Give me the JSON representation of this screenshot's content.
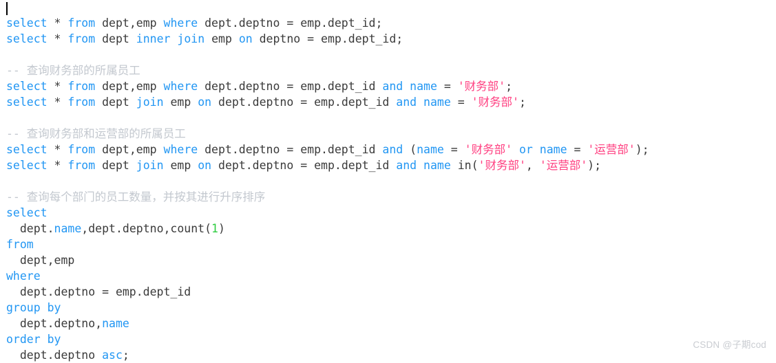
{
  "editor": {
    "background_color": "#ffffff",
    "caret_visible": true,
    "font_size_px": 16.5,
    "line_height_px": 23
  },
  "theme": {
    "keyword_color": "#2196F3",
    "identifier_color": "#3a3a3a",
    "comment_color": "#c3c8cf",
    "string_color": "#ff4081",
    "number_color": "#2ecc40",
    "caret_color": "#000000",
    "watermark_color": "#c9ccd1"
  },
  "watermark": {
    "text": "CSDN @子期cod"
  },
  "code": {
    "language": "sql",
    "plain_text": "select * from dept,emp where dept.deptno = emp.dept_id;\nselect * from dept inner join emp on deptno = emp.dept_id;\n\n-- 查询财务部的所属员工\nselect * from dept,emp where dept.deptno = emp.dept_id and name = '财务部';\nselect * from dept join emp on dept.deptno = emp.dept_id and name = '财务部';\n\n-- 查询财务部和运营部的所属员工\nselect * from dept,emp where dept.deptno = emp.dept_id and (name = '财务部' or name = '运营部');\nselect * from dept join emp on dept.deptno = emp.dept_id and name in('财务部', '运营部');\n\n-- 查询每个部门的员工数量，并按其进行升序排序\nselect\n  dept.name,dept.deptno,count(1)\nfrom\n  dept,emp\nwhere\n  dept.deptno = emp.dept_id\ngroup by\n  dept.deptno,name\norder by\n  dept.deptno asc;",
    "lines": [
      {
        "index": 1,
        "text": "select * from dept,emp where dept.deptno = emp.dept_id;",
        "tokens": [
          {
            "t": "select",
            "c": "kw"
          },
          {
            "t": " ",
            "c": "op"
          },
          {
            "t": "*",
            "c": "id"
          },
          {
            "t": " ",
            "c": "op"
          },
          {
            "t": "from",
            "c": "kw"
          },
          {
            "t": " dept,emp ",
            "c": "id"
          },
          {
            "t": "where",
            "c": "kw"
          },
          {
            "t": " dept.deptno = emp.dept_id;",
            "c": "id"
          }
        ]
      },
      {
        "index": 2,
        "text": "select * from dept inner join emp on deptno = emp.dept_id;",
        "tokens": [
          {
            "t": "select",
            "c": "kw"
          },
          {
            "t": " ",
            "c": "op"
          },
          {
            "t": "*",
            "c": "id"
          },
          {
            "t": " ",
            "c": "op"
          },
          {
            "t": "from",
            "c": "kw"
          },
          {
            "t": " dept ",
            "c": "id"
          },
          {
            "t": "inner",
            "c": "kw"
          },
          {
            "t": " ",
            "c": "op"
          },
          {
            "t": "join",
            "c": "kw"
          },
          {
            "t": " emp ",
            "c": "id"
          },
          {
            "t": "on",
            "c": "kw"
          },
          {
            "t": " deptno = emp.dept_id;",
            "c": "id"
          }
        ]
      },
      {
        "index": 3,
        "text": "",
        "tokens": []
      },
      {
        "index": 4,
        "text": "-- 查询财务部的所属员工",
        "tokens": [
          {
            "t": "-- 查询财务部的所属员工",
            "c": "cmt"
          }
        ]
      },
      {
        "index": 5,
        "text": "select * from dept,emp where dept.deptno = emp.dept_id and name = '财务部';",
        "tokens": [
          {
            "t": "select",
            "c": "kw"
          },
          {
            "t": " ",
            "c": "op"
          },
          {
            "t": "*",
            "c": "id"
          },
          {
            "t": " ",
            "c": "op"
          },
          {
            "t": "from",
            "c": "kw"
          },
          {
            "t": " dept,emp ",
            "c": "id"
          },
          {
            "t": "where",
            "c": "kw"
          },
          {
            "t": " dept.deptno = emp.dept_id ",
            "c": "id"
          },
          {
            "t": "and",
            "c": "kw"
          },
          {
            "t": " ",
            "c": "op"
          },
          {
            "t": "name",
            "c": "kw"
          },
          {
            "t": " = ",
            "c": "id"
          },
          {
            "t": "'财务部'",
            "c": "str"
          },
          {
            "t": ";",
            "c": "id"
          }
        ]
      },
      {
        "index": 6,
        "text": "select * from dept join emp on dept.deptno = emp.dept_id and name = '财务部';",
        "tokens": [
          {
            "t": "select",
            "c": "kw"
          },
          {
            "t": " ",
            "c": "op"
          },
          {
            "t": "*",
            "c": "id"
          },
          {
            "t": " ",
            "c": "op"
          },
          {
            "t": "from",
            "c": "kw"
          },
          {
            "t": " dept ",
            "c": "id"
          },
          {
            "t": "join",
            "c": "kw"
          },
          {
            "t": " emp ",
            "c": "id"
          },
          {
            "t": "on",
            "c": "kw"
          },
          {
            "t": " dept.deptno = emp.dept_id ",
            "c": "id"
          },
          {
            "t": "and",
            "c": "kw"
          },
          {
            "t": " ",
            "c": "op"
          },
          {
            "t": "name",
            "c": "kw"
          },
          {
            "t": " = ",
            "c": "id"
          },
          {
            "t": "'财务部'",
            "c": "str"
          },
          {
            "t": ";",
            "c": "id"
          }
        ]
      },
      {
        "index": 7,
        "text": "",
        "tokens": []
      },
      {
        "index": 8,
        "text": "-- 查询财务部和运营部的所属员工",
        "tokens": [
          {
            "t": "-- 查询财务部和运营部的所属员工",
            "c": "cmt"
          }
        ]
      },
      {
        "index": 9,
        "text": "select * from dept,emp where dept.deptno = emp.dept_id and (name = '财务部' or name = '运营部');",
        "tokens": [
          {
            "t": "select",
            "c": "kw"
          },
          {
            "t": " ",
            "c": "op"
          },
          {
            "t": "*",
            "c": "id"
          },
          {
            "t": " ",
            "c": "op"
          },
          {
            "t": "from",
            "c": "kw"
          },
          {
            "t": " dept,emp ",
            "c": "id"
          },
          {
            "t": "where",
            "c": "kw"
          },
          {
            "t": " dept.deptno = emp.dept_id ",
            "c": "id"
          },
          {
            "t": "and",
            "c": "kw"
          },
          {
            "t": " (",
            "c": "id"
          },
          {
            "t": "name",
            "c": "kw"
          },
          {
            "t": " = ",
            "c": "id"
          },
          {
            "t": "'财务部'",
            "c": "str"
          },
          {
            "t": " ",
            "c": "op"
          },
          {
            "t": "or",
            "c": "kw"
          },
          {
            "t": " ",
            "c": "op"
          },
          {
            "t": "name",
            "c": "kw"
          },
          {
            "t": " = ",
            "c": "id"
          },
          {
            "t": "'运营部'",
            "c": "str"
          },
          {
            "t": ");",
            "c": "id"
          }
        ]
      },
      {
        "index": 10,
        "text": "select * from dept join emp on dept.deptno = emp.dept_id and name in('财务部', '运营部');",
        "tokens": [
          {
            "t": "select",
            "c": "kw"
          },
          {
            "t": " ",
            "c": "op"
          },
          {
            "t": "*",
            "c": "id"
          },
          {
            "t": " ",
            "c": "op"
          },
          {
            "t": "from",
            "c": "kw"
          },
          {
            "t": " dept ",
            "c": "id"
          },
          {
            "t": "join",
            "c": "kw"
          },
          {
            "t": " emp ",
            "c": "id"
          },
          {
            "t": "on",
            "c": "kw"
          },
          {
            "t": " dept.deptno = emp.dept_id ",
            "c": "id"
          },
          {
            "t": "and",
            "c": "kw"
          },
          {
            "t": " ",
            "c": "op"
          },
          {
            "t": "name",
            "c": "kw"
          },
          {
            "t": " in(",
            "c": "id"
          },
          {
            "t": "'财务部'",
            "c": "str"
          },
          {
            "t": ", ",
            "c": "id"
          },
          {
            "t": "'运营部'",
            "c": "str"
          },
          {
            "t": ");",
            "c": "id"
          }
        ]
      },
      {
        "index": 11,
        "text": "",
        "tokens": []
      },
      {
        "index": 12,
        "text": "-- 查询每个部门的员工数量，并按其进行升序排序",
        "tokens": [
          {
            "t": "-- 查询每个部门的员工数量，并按其进行升序排序",
            "c": "cmt"
          }
        ]
      },
      {
        "index": 13,
        "text": "select",
        "tokens": [
          {
            "t": "select",
            "c": "kw"
          }
        ]
      },
      {
        "index": 14,
        "text": "  dept.name,dept.deptno,count(1)",
        "tokens": [
          {
            "t": "  dept.",
            "c": "id"
          },
          {
            "t": "name",
            "c": "kw"
          },
          {
            "t": ",dept.deptno,count(",
            "c": "id"
          },
          {
            "t": "1",
            "c": "num"
          },
          {
            "t": ")",
            "c": "id"
          }
        ]
      },
      {
        "index": 15,
        "text": "from",
        "tokens": [
          {
            "t": "from",
            "c": "kw"
          }
        ]
      },
      {
        "index": 16,
        "text": "  dept,emp",
        "tokens": [
          {
            "t": "  dept,emp",
            "c": "id"
          }
        ]
      },
      {
        "index": 17,
        "text": "where",
        "tokens": [
          {
            "t": "where",
            "c": "kw"
          }
        ]
      },
      {
        "index": 18,
        "text": "  dept.deptno = emp.dept_id",
        "tokens": [
          {
            "t": "  dept.deptno = emp.dept_id",
            "c": "id"
          }
        ]
      },
      {
        "index": 19,
        "text": "group by",
        "tokens": [
          {
            "t": "group",
            "c": "kw"
          },
          {
            "t": " ",
            "c": "op"
          },
          {
            "t": "by",
            "c": "kw"
          }
        ]
      },
      {
        "index": 20,
        "text": "  dept.deptno,name",
        "tokens": [
          {
            "t": "  dept.deptno,",
            "c": "id"
          },
          {
            "t": "name",
            "c": "kw"
          }
        ]
      },
      {
        "index": 21,
        "text": "order by",
        "tokens": [
          {
            "t": "order",
            "c": "kw"
          },
          {
            "t": " ",
            "c": "op"
          },
          {
            "t": "by",
            "c": "kw"
          }
        ]
      },
      {
        "index": 22,
        "text": "  dept.deptno asc;",
        "tokens": [
          {
            "t": "  dept.deptno ",
            "c": "id"
          },
          {
            "t": "asc",
            "c": "kw"
          },
          {
            "t": ";",
            "c": "id"
          }
        ]
      }
    ]
  }
}
